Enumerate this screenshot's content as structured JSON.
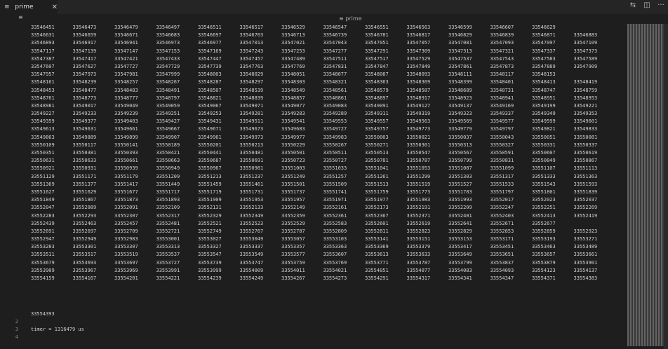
{
  "tab": {
    "icon": "≡",
    "name": "prime",
    "close": "✕"
  },
  "actions": [
    "split-compare",
    "split-editor",
    "more"
  ],
  "breadcrumb": {
    "icon": "≡",
    "label": "prime"
  },
  "lines": [
    "2",
    "3",
    "4"
  ],
  "output": {
    "last_value": "33554393",
    "timer": "timer = 1316479 us"
  },
  "rows": [
    [
      "33546451",
      "33546473",
      "33546479",
      "33546497",
      "33546511",
      "33546517",
      "33546529",
      "33546547",
      "33546551",
      "33546563",
      "33546599",
      "33546607",
      "33546629"
    ],
    [
      "33546631",
      "33546659",
      "33546671",
      "33546683",
      "33546697",
      "33546703",
      "33546713",
      "33546739",
      "33546781",
      "33546817",
      "33546829",
      "33546839",
      "33546871",
      "33546883"
    ],
    [
      "33546893",
      "33546917",
      "33546941",
      "33546973",
      "33546977",
      "33547013",
      "33547021",
      "33547043",
      "33547051",
      "33547057",
      "33547081",
      "33547093",
      "33547097",
      "33547109"
    ],
    [
      "33547117",
      "33547139",
      "33547147",
      "33547153",
      "33547169",
      "33547243",
      "33547253",
      "33547277",
      "33547291",
      "33547309",
      "33547313",
      "33547321",
      "33547337",
      "33547373"
    ],
    [
      "33547387",
      "33547417",
      "33547421",
      "33547433",
      "33547447",
      "33547457",
      "33547489",
      "33547511",
      "33547517",
      "33547529",
      "33547537",
      "33547543",
      "33547583",
      "33547589"
    ],
    [
      "33547607",
      "33547627",
      "33547727",
      "33547729",
      "33547739",
      "33547763",
      "33547769",
      "33547831",
      "33547847",
      "33547849",
      "33547861",
      "33547873",
      "33547889",
      "33547909"
    ],
    [
      "33547957",
      "33547973",
      "33547981",
      "33547999",
      "33548003",
      "33548029",
      "33548051",
      "33548077",
      "33548087",
      "33548093",
      "33548111",
      "33548117",
      "33548153"
    ],
    [
      "33548161",
      "33548239",
      "33548257",
      "33548267",
      "33548287",
      "33548297",
      "33548303",
      "33548321",
      "33548363",
      "33548369",
      "33548399",
      "33548401",
      "33548413",
      "33548419"
    ],
    [
      "33548453",
      "33548477",
      "33548483",
      "33548491",
      "33548507",
      "33548539",
      "33548549",
      "33548561",
      "33548579",
      "33548587",
      "33548689",
      "33548731",
      "33548747",
      "33548759"
    ],
    [
      "33548761",
      "33548773",
      "33548777",
      "33548797",
      "33548821",
      "33548839",
      "33548857",
      "33548861",
      "33548897",
      "33548917",
      "33548923",
      "33548941",
      "33548951",
      "33548953"
    ],
    [
      "33548981",
      "33549017",
      "33549049",
      "33549059",
      "33549067",
      "33549071",
      "33549077",
      "33549083",
      "33549091",
      "33549127",
      "33549137",
      "33549169",
      "33549199",
      "33549221"
    ],
    [
      "33549227",
      "33549233",
      "33549239",
      "33549251",
      "33549253",
      "33549281",
      "33549283",
      "33549289",
      "33549311",
      "33549319",
      "33549323",
      "33549337",
      "33549349",
      "33549353"
    ],
    [
      "33549359",
      "33549377",
      "33549403",
      "33549427",
      "33549431",
      "33549511",
      "33549541",
      "33549553",
      "33549557",
      "33549563",
      "33549569",
      "33549577",
      "33549599",
      "33549601"
    ],
    [
      "33549613",
      "33549631",
      "33549661",
      "33549667",
      "33549671",
      "33549673",
      "33549683",
      "33549727",
      "33549757",
      "33549773",
      "33549779",
      "33549797",
      "33549821",
      "33549833"
    ],
    [
      "33549863",
      "33549889",
      "33549899",
      "33549907",
      "33549961",
      "33549973",
      "33549977",
      "33549983",
      "33550003",
      "33550021",
      "33550037",
      "33550043",
      "33550051",
      "33550081"
    ],
    [
      "33550109",
      "33550117",
      "33550141",
      "33550189",
      "33550201",
      "33550213",
      "33550229",
      "33550267",
      "33550271",
      "33550301",
      "33550313",
      "33550327",
      "33550331",
      "33550337"
    ],
    [
      "33550351",
      "33550381",
      "33550393",
      "33550421",
      "33550441",
      "33550481",
      "33550501",
      "33550511",
      "33550513",
      "33550547",
      "33550567",
      "33550591",
      "33550607",
      "33550619"
    ],
    [
      "33550631",
      "33550633",
      "33550661",
      "33550663",
      "33550687",
      "33550691",
      "33550723",
      "33550727",
      "33550781",
      "33550787",
      "33550799",
      "33550831",
      "33550849",
      "33550867"
    ],
    [
      "33550921",
      "33550931",
      "33550939",
      "33550949",
      "33550967",
      "33550981",
      "33551003",
      "33551033",
      "33551041",
      "33551053",
      "33551087",
      "33551099",
      "33551107",
      "33551113"
    ],
    [
      "33551129",
      "33551171",
      "33551179",
      "33551209",
      "33551213",
      "33551237",
      "33551249",
      "33551257",
      "33551261",
      "33551299",
      "33551303",
      "33551317",
      "33551333",
      "33551363"
    ],
    [
      "33551369",
      "33551377",
      "33551417",
      "33551449",
      "33551459",
      "33551461",
      "33551501",
      "33551509",
      "33551513",
      "33551519",
      "33551527",
      "33551533",
      "33551543",
      "33551593"
    ],
    [
      "33551627",
      "33551629",
      "33551677",
      "33551717",
      "33551719",
      "33551731",
      "33551737",
      "33551741",
      "33551759",
      "33551773",
      "33551783",
      "33551797",
      "33551801",
      "33551839"
    ],
    [
      "33551849",
      "33551867",
      "33551873",
      "33551893",
      "33551909",
      "33551953",
      "33551957",
      "33551971",
      "33551977",
      "33551983",
      "33551993",
      "33552017",
      "33552023",
      "33552037"
    ],
    [
      "33552047",
      "33552089",
      "33552091",
      "33552109",
      "33552131",
      "33552133",
      "33552149",
      "33552161",
      "33552173",
      "33552191",
      "33552209",
      "33552247",
      "33552251",
      "33552269"
    ],
    [
      "33552283",
      "33552293",
      "33552307",
      "33552317",
      "33552329",
      "33552349",
      "33552359",
      "33552361",
      "33552367",
      "33552371",
      "33552401",
      "33552403",
      "33552413",
      "33552419"
    ],
    [
      "33552439",
      "33552463",
      "33552457",
      "33552481",
      "33552521",
      "33552523",
      "33552529",
      "33552583",
      "33552601",
      "33552619",
      "33552641",
      "33552671",
      "33552677"
    ],
    [
      "33552691",
      "33552697",
      "33552709",
      "33552721",
      "33552749",
      "33552767",
      "33552787",
      "33552809",
      "33552811",
      "33552823",
      "33552829",
      "33552853",
      "33552859",
      "33552923"
    ],
    [
      "33552947",
      "33552949",
      "33552983",
      "33553001",
      "33553027",
      "33553049",
      "33553057",
      "33553103",
      "33553141",
      "33553151",
      "33553153",
      "33553171",
      "33553193",
      "33553271"
    ],
    [
      "33553283",
      "33553301",
      "33553307",
      "33553313",
      "33553327",
      "33553337",
      "33553357",
      "33553363",
      "33553369",
      "33553379",
      "33553417",
      "33553451",
      "33553463",
      "33553489"
    ],
    [
      "33553511",
      "33553517",
      "33553519",
      "33553537",
      "33553547",
      "33553549",
      "33553577",
      "33553607",
      "33553613",
      "33553633",
      "33553649",
      "33553651",
      "33553657",
      "33553661"
    ],
    [
      "33553679",
      "33553693",
      "33553697",
      "33553727",
      "33553739",
      "33553747",
      "33553759",
      "33553769",
      "33553771",
      "33553787",
      "33553799",
      "33553837",
      "33553879",
      "33553901"
    ],
    [
      "33553909",
      "33553967",
      "33553969",
      "33553991",
      "33553999",
      "33554009",
      "33554011",
      "33554021",
      "33554051",
      "33554077",
      "33554083",
      "33554093",
      "33554123",
      "33554137"
    ],
    [
      "33554159",
      "33554167",
      "33554201",
      "33554221",
      "33554239",
      "33554249",
      "33554267",
      "33554273",
      "33554291",
      "33554317",
      "33554341",
      "33554347",
      "33554371",
      "33554383"
    ]
  ]
}
